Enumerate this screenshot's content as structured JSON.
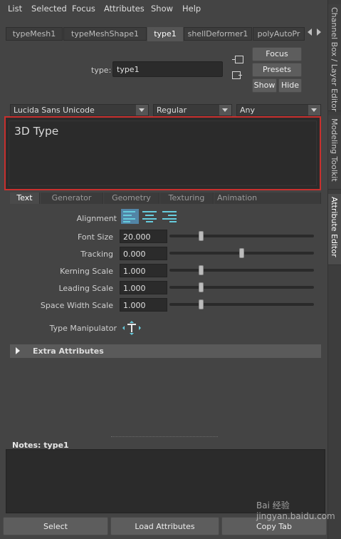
{
  "menu": [
    "List",
    "Selected",
    "Focus",
    "Attributes",
    "Show",
    "Help"
  ],
  "tabs": [
    "typeMesh1",
    "typeMeshShape1",
    "type1",
    "shellDeformer1",
    "polyAutoPr"
  ],
  "active_tab": "type1",
  "node": {
    "label": "type:",
    "value": "type1"
  },
  "buttons": {
    "focus": "Focus",
    "presets": "Presets",
    "show": "Show",
    "hide": "Hide"
  },
  "font": {
    "family": "Lucida Sans Unicode",
    "style": "Regular",
    "writing_system": "Any"
  },
  "text_content": "3D Type",
  "subtabs": [
    "Text",
    "Generator",
    "Geometry",
    "Texturing",
    "Animation"
  ],
  "active_subtab": "Text",
  "alignment": {
    "label": "Alignment",
    "selected": "left"
  },
  "attributes": [
    {
      "label": "Font Size",
      "value": "20.000",
      "slider_fraction": 0.21
    },
    {
      "label": "Tracking",
      "value": "0.000",
      "slider_fraction": 0.5
    },
    {
      "label": "Kerning Scale",
      "value": "1.000",
      "slider_fraction": 0.21
    },
    {
      "label": "Leading Scale",
      "value": "1.000",
      "slider_fraction": 0.21
    },
    {
      "label": "Space Width Scale",
      "value": "1.000",
      "slider_fraction": 0.21
    }
  ],
  "manipulator": {
    "label": "Type Manipulator"
  },
  "extra_attributes": "Extra Attributes",
  "notes": {
    "label": "Notes:",
    "node": "type1"
  },
  "bottom_buttons": [
    "Select",
    "Load Attributes",
    "Copy Tab"
  ],
  "side_tabs": [
    "Channel Box / Layer Editor",
    "Modeling Toolkit",
    "Attribute Editor"
  ],
  "watermark": "Bai 经验 jingyan.baidu.com",
  "colors": {
    "highlight_border": "#c8302e",
    "accent": "#5285a6",
    "align_lines": "#66ccdd"
  },
  "icons": [
    "tab-scroll-left-icon",
    "tab-scroll-right-icon",
    "load-selected-icon",
    "copy-tab-icon",
    "align-left-icon",
    "align-center-icon",
    "align-right-icon",
    "type-manipulator-icon",
    "expand-triangle-icon"
  ]
}
